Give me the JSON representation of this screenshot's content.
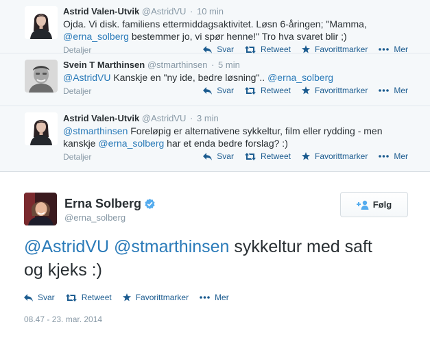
{
  "conversation": [
    {
      "fullname": "Astrid Valen-Utvik",
      "username": "@AstridVU",
      "time": "10 min",
      "text_segments": [
        {
          "text": "Ojda. Vi disk. familiens ettermiddagsaktivitet. Løsn 6-åringen; \"Mamma, ",
          "mention": false
        },
        {
          "text": "@erna_solberg",
          "mention": true
        },
        {
          "text": " bestemmer jo, vi spør henne!\" Tro hva svaret blir ;)",
          "mention": false
        }
      ],
      "details": "Detaljer"
    },
    {
      "fullname": "Svein T Marthinsen",
      "username": "@stmarthinsen",
      "time": "5 min",
      "text_segments": [
        {
          "text": "@AstridVU",
          "mention": true
        },
        {
          "text": " Kanskje en \"ny ide, bedre løsning\".. ",
          "mention": false
        },
        {
          "text": "@erna_solberg",
          "mention": true
        }
      ],
      "details": "Detaljer"
    },
    {
      "fullname": "Astrid Valen-Utvik",
      "username": "@AstridVU",
      "time": "3 min",
      "text_segments": [
        {
          "text": "@stmarthinsen",
          "mention": true
        },
        {
          "text": " Foreløpig er alternativene sykkeltur, film eller rydding - men kanskje ",
          "mention": false
        },
        {
          "text": "@erna_solberg",
          "mention": true
        },
        {
          "text": " har et enda bedre forslag? :)",
          "mention": false
        }
      ],
      "details": "Detaljer"
    }
  ],
  "actions": {
    "reply": "Svar",
    "retweet": "Retweet",
    "favorite": "Favorittmarker",
    "more": "Mer"
  },
  "main_tweet": {
    "fullname": "Erna Solberg",
    "username": "@erna_solberg",
    "verified": true,
    "follow_label": "Følg",
    "text_mention_1": "@AstridVU",
    "text_mention_2": "@stmarthinsen",
    "text_rest": " sykkeltur med saft og kjeks  :)",
    "timestamp": "08.47 - 23. mar. 2014"
  },
  "colors": {
    "link": "#2b7bb9",
    "action": "#1b5b8f",
    "muted": "#8899a6",
    "verified": "#55acee",
    "conversation_bg": "#f5f8fa"
  }
}
